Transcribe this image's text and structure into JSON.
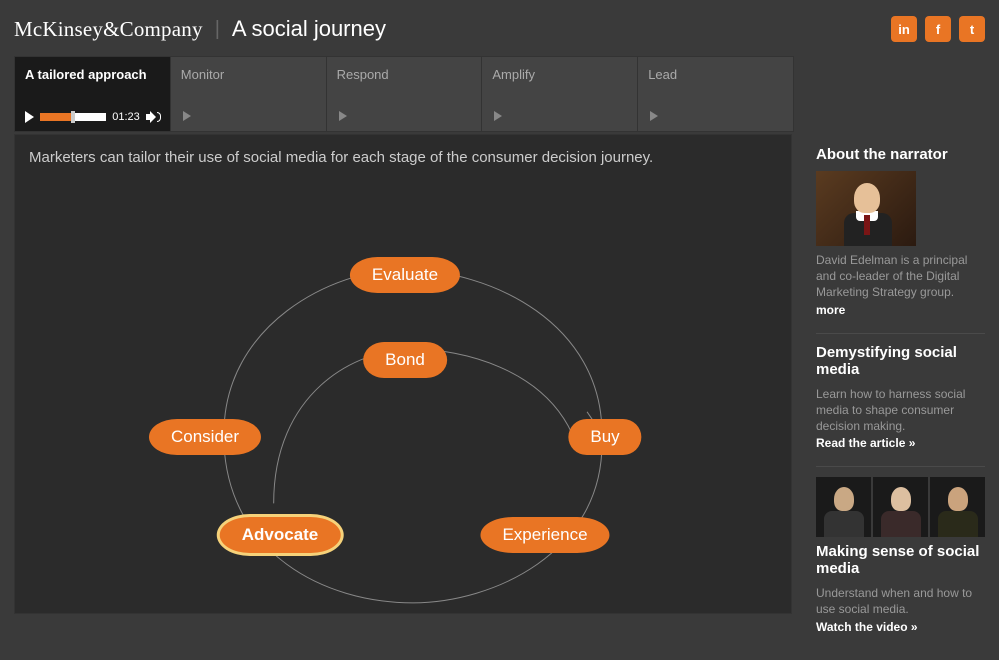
{
  "header": {
    "company": "McKinsey&Company",
    "page_title": "A social journey",
    "social_icons": [
      "in",
      "f",
      "t"
    ]
  },
  "tabs": [
    {
      "label": "A tailored approach",
      "active": true
    },
    {
      "label": "Monitor",
      "active": false
    },
    {
      "label": "Respond",
      "active": false
    },
    {
      "label": "Amplify",
      "active": false
    },
    {
      "label": "Lead",
      "active": false
    }
  ],
  "player": {
    "progress_pct": 47,
    "time": "01:23"
  },
  "stage": {
    "caption": "Marketers can tailor their use of social media for each stage of the consumer decision journey.",
    "nodes": {
      "evaluate": "Evaluate",
      "bond": "Bond",
      "consider": "Consider",
      "buy": "Buy",
      "advocate": "Advocate",
      "experience": "Experience"
    }
  },
  "sidebar": {
    "narrator": {
      "heading": "About the narrator",
      "text": "David Edelman is a principal and co-leader of the Digital Marketing Strategy group.",
      "link": "more"
    },
    "demystify": {
      "heading": "Demystifying social media",
      "text": "Learn how to harness social media to shape consumer decision making.",
      "link": "Read the article »"
    },
    "making_sense": {
      "heading": "Making sense of social media",
      "text": "Understand when and how to use social media.",
      "link": "Watch the video »"
    }
  }
}
